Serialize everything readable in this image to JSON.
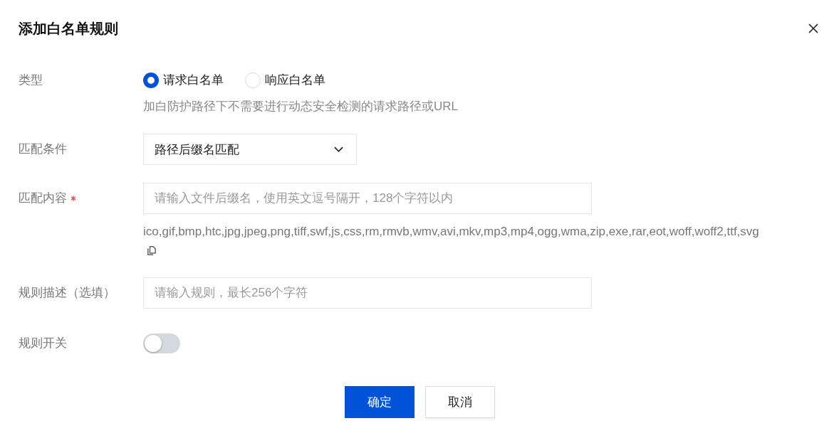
{
  "dialog": {
    "title": "添加白名单规则"
  },
  "form": {
    "type": {
      "label": "类型",
      "options": [
        {
          "label": "请求白名单",
          "selected": true
        },
        {
          "label": "响应白名单",
          "selected": false
        }
      ],
      "hint": "加白防护路径下不需要进行动态安全检测的请求路径或URL"
    },
    "match_condition": {
      "label": "匹配条件",
      "value": "路径后缀名匹配"
    },
    "match_content": {
      "label": "匹配内容",
      "required": true,
      "placeholder": "请输入文件后缀名，使用英文逗号隔开，128个字符以内",
      "suggestion": "ico,gif,bmp,htc,jpg,jpeg,png,tiff,swf,js,css,rm,rmvb,wmv,avi,mkv,mp3,mp4,ogg,wma,zip,exe,rar,eot,woff,woff2,ttf,svg"
    },
    "description": {
      "label": "规则描述（选填）",
      "placeholder": "请输入规则，最长256个字符"
    },
    "rule_switch": {
      "label": "规则开关",
      "on": false
    }
  },
  "buttons": [
    {
      "label": "确定",
      "kind": "primary"
    },
    {
      "label": "取消",
      "kind": "secondary"
    }
  ]
}
